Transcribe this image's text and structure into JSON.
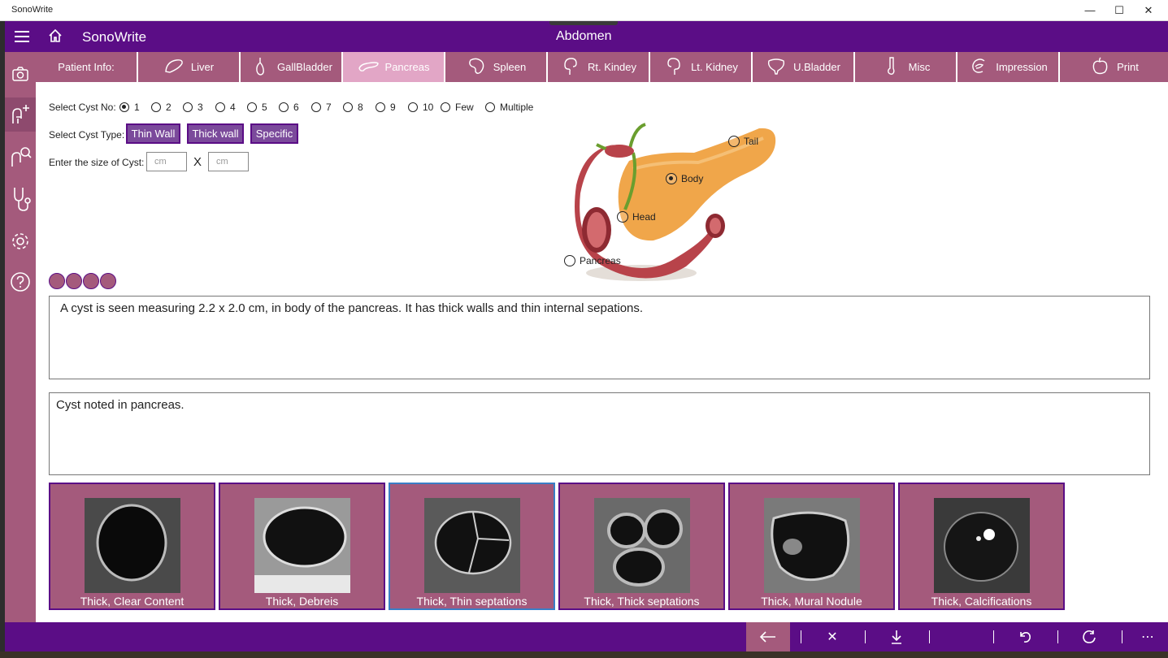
{
  "window": {
    "title": "SonoWrite"
  },
  "appbar": {
    "app_name": "SonoWrite",
    "section": "Abdomen"
  },
  "rail": {
    "items": [
      "camera-icon",
      "add-patient-icon",
      "search-patient-icon",
      "stethoscope-icon",
      "settings-icon",
      "help-icon"
    ]
  },
  "tabs": [
    {
      "label": "Patient Info:",
      "icon": ""
    },
    {
      "label": "Liver",
      "icon": "liver-icon"
    },
    {
      "label": "GallBladder",
      "icon": "gallbladder-icon"
    },
    {
      "label": "Pancreas",
      "icon": "pancreas-icon",
      "active": true
    },
    {
      "label": "Spleen",
      "icon": "spleen-icon"
    },
    {
      "label": "Rt. Kindey",
      "icon": "kidney-icon"
    },
    {
      "label": "Lt. Kidney",
      "icon": "kidney-icon"
    },
    {
      "label": "U.Bladder",
      "icon": "bladder-icon"
    },
    {
      "label": "Misc",
      "icon": "thermometer-icon"
    },
    {
      "label": "Impression",
      "icon": "impression-icon"
    },
    {
      "label": "Print",
      "icon": "print-icon"
    }
  ],
  "form": {
    "cyst_no_label": "Select Cyst No:",
    "cyst_no_options": [
      "1",
      "2",
      "3",
      "4",
      "5",
      "6",
      "7",
      "8",
      "9",
      "10",
      "Few",
      "Multiple"
    ],
    "cyst_no_selected": "1",
    "cyst_type_label": "Select Cyst Type:",
    "cyst_types": [
      "Thin Wall",
      "Thick wall",
      "Specific"
    ],
    "size_label": "Enter the size of Cyst:",
    "size_placeholder": "cm",
    "size_separator": "X"
  },
  "diagram": {
    "points": [
      {
        "label": "Tail",
        "selected": false
      },
      {
        "label": "Body",
        "selected": true
      },
      {
        "label": "Head",
        "selected": false
      },
      {
        "label": "Pancreas",
        "selected": false
      }
    ]
  },
  "findings_text": "A cyst is seen measuring 2.2 x 2.0 cm, in body of the pancreas. It has thick walls and thin internal sepations.",
  "impression_text": "Cyst noted in pancreas.",
  "thumbnails": [
    {
      "caption": "Thick, Clear Content"
    },
    {
      "caption": "Thick, Debreis"
    },
    {
      "caption": "Thick, Thin septations",
      "selected": true
    },
    {
      "caption": "Thick, Thick septations"
    },
    {
      "caption": "Thick, Mural Nodule"
    },
    {
      "caption": "Thick, Calcifications"
    }
  ],
  "bottombar": {
    "buttons": [
      "back-arrow-icon",
      "close-icon",
      "download-icon",
      "undo-icon",
      "refresh-icon",
      "more-icon"
    ]
  },
  "colors": {
    "appbar": "#5b0d86",
    "tab": "#a45a7c",
    "tab_active": "#e2a6c6",
    "button": "#7b4a9b"
  }
}
